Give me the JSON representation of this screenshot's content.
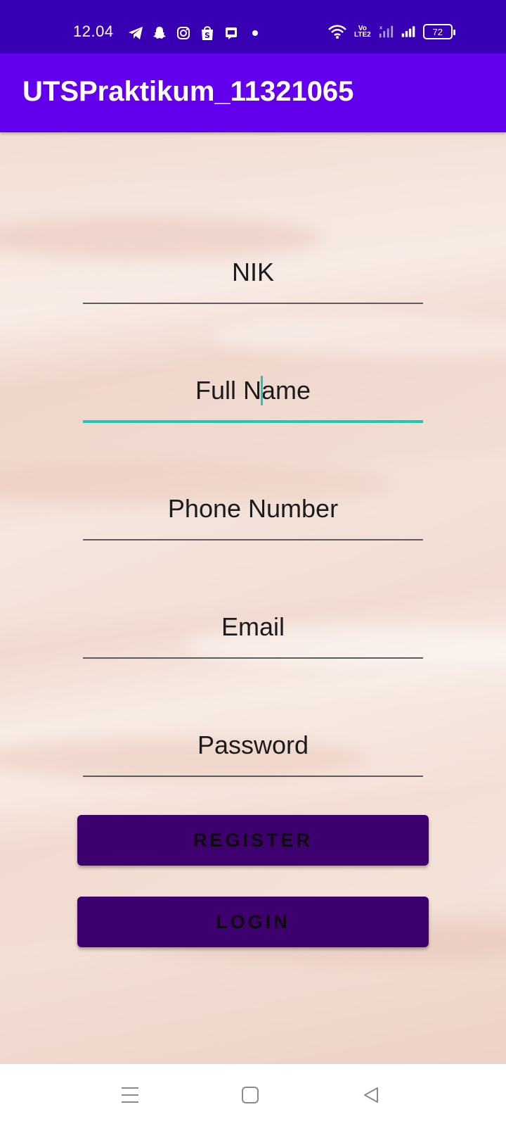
{
  "status_bar": {
    "time": "12.04",
    "left_icons": [
      "telegram-icon",
      "snapchat-icon",
      "instagram-icon",
      "shopee-icon",
      "messenger-app-icon",
      "notification-dot-icon"
    ],
    "right_icons": [
      "wifi-icon",
      "volte-icon",
      "signal-sim2-icon",
      "signal-sim1-icon",
      "battery-icon"
    ],
    "volte_top": "Vo",
    "volte_bottom": "LTE2",
    "battery_level": "72"
  },
  "app_bar": {
    "title": "UTSPraktikum_11321065",
    "color": "#6200ee",
    "status_color": "#3700b3"
  },
  "form": {
    "fields": [
      {
        "hint": "NIK",
        "focused": false
      },
      {
        "hint_before_caret": "Full N",
        "hint_after_caret": "ame",
        "focused": true
      },
      {
        "hint": "Phone Number",
        "focused": false
      },
      {
        "hint": "Email",
        "focused": false
      },
      {
        "hint": "Password",
        "focused": false
      }
    ],
    "accent_color": "#1fc8b4"
  },
  "buttons": {
    "register_label": "REGISTER",
    "login_label": "LOGIN",
    "color": "#3d006e"
  },
  "nav_bar": {
    "icons": [
      "menu-icon",
      "home-square-icon",
      "back-triangle-icon"
    ]
  }
}
